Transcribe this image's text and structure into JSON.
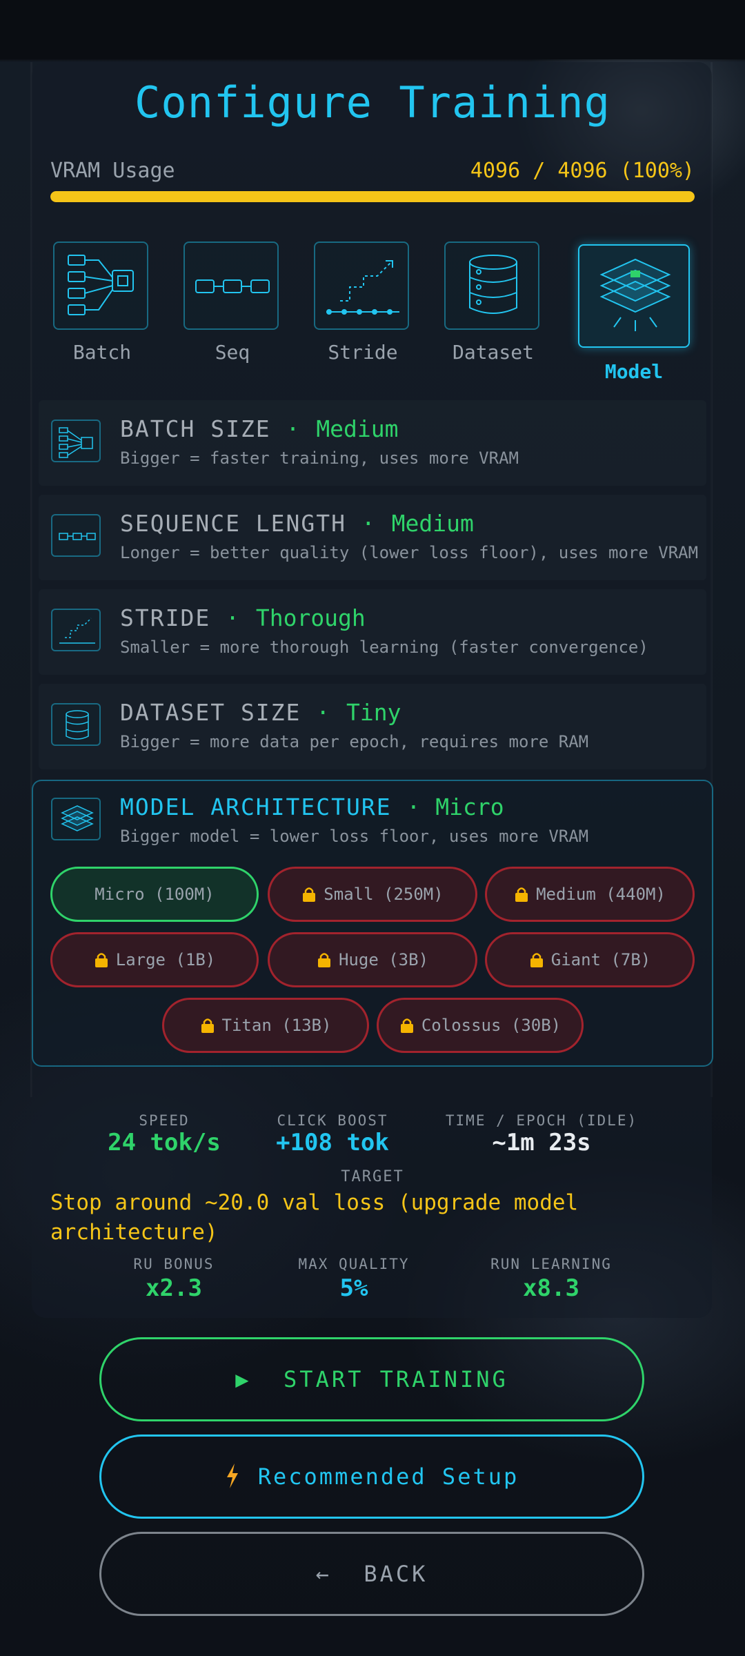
{
  "title": "Configure Training",
  "vram": {
    "label": "VRAM Usage",
    "value_text": "4096 / 4096 (100%)",
    "fraction": 1.0,
    "color": "#f5c518"
  },
  "tabs": [
    {
      "label": "Batch",
      "icon": "batch-icon"
    },
    {
      "label": "Seq",
      "icon": "sequence-icon"
    },
    {
      "label": "Stride",
      "icon": "stride-icon"
    },
    {
      "label": "Dataset",
      "icon": "dataset-icon"
    },
    {
      "label": "Model",
      "icon": "model-layers-icon",
      "active": true
    }
  ],
  "settings": [
    {
      "title": "BATCH SIZE",
      "value": "Medium",
      "desc": "Bigger = faster training, uses more VRAM"
    },
    {
      "title": "SEQUENCE LENGTH",
      "value": "Medium",
      "desc": "Longer = better quality (lower loss floor), uses more VRAM"
    },
    {
      "title": "STRIDE",
      "value": "Thorough",
      "desc": "Smaller = more thorough learning (faster convergence)"
    },
    {
      "title": "DATASET SIZE",
      "value": "Tiny",
      "desc": "Bigger = more data per epoch, requires more RAM"
    },
    {
      "title": "MODEL ARCHITECTURE",
      "value": "Micro",
      "desc": "Bigger model = lower loss floor, uses more VRAM"
    }
  ],
  "separator": "·",
  "models": [
    {
      "label": "Micro (100M)",
      "locked": false,
      "selected": true
    },
    {
      "label": "Small (250M)",
      "locked": true
    },
    {
      "label": "Medium (440M)",
      "locked": true
    },
    {
      "label": "Large (1B)",
      "locked": true
    },
    {
      "label": "Huge (3B)",
      "locked": true
    },
    {
      "label": "Giant (7B)",
      "locked": true
    },
    {
      "label": "Titan (13B)",
      "locked": true
    },
    {
      "label": "Colossus (30B)",
      "locked": true
    }
  ],
  "stats": {
    "speed": {
      "label": "SPEED",
      "value": "24 tok/s"
    },
    "click_boost": {
      "label": "CLICK BOOST",
      "value": "+108 tok"
    },
    "time_epoch": {
      "label": "TIME / EPOCH (IDLE)",
      "value": "~1m 23s"
    },
    "ru_bonus": {
      "label": "RU BONUS",
      "value": "x2.3"
    },
    "max_quality": {
      "label": "MAX QUALITY",
      "value": "5%"
    },
    "run_learning": {
      "label": "RUN LEARNING",
      "value": "x8.3"
    }
  },
  "target": {
    "label": "TARGET",
    "text": "Stop around ~20.0 val loss (upgrade model architecture)"
  },
  "buttons": {
    "start": {
      "icon": "play-icon",
      "glyph": "▶",
      "label": "START TRAINING"
    },
    "recommended": {
      "icon": "lightning-bolt-icon",
      "label": "Recommended Setup"
    },
    "back": {
      "icon": "back-arrow-icon",
      "glyph": "←",
      "label": "BACK"
    }
  },
  "colors": {
    "accent_cyan": "#22c5f0",
    "accent_green": "#2fd36a",
    "warning_yellow": "#f5c518",
    "locked_red": "#c82832"
  }
}
